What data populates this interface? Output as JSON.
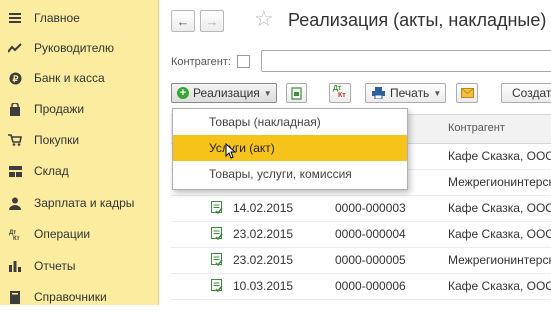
{
  "sidebar": {
    "items": [
      {
        "label": "Главное",
        "icon": "menu-icon"
      },
      {
        "label": "Руководителю",
        "icon": "trend-icon"
      },
      {
        "label": "Банк и касса",
        "icon": "coin-icon"
      },
      {
        "label": "Продажи",
        "icon": "bag-icon"
      },
      {
        "label": "Покупки",
        "icon": "cart-icon"
      },
      {
        "label": "Склад",
        "icon": "warehouse-icon"
      },
      {
        "label": "Зарплата и кадры",
        "icon": "person-icon"
      },
      {
        "label": "Операции",
        "icon": "operations-icon"
      },
      {
        "label": "Отчеты",
        "icon": "bar-chart-icon"
      },
      {
        "label": "Справочники",
        "icon": "book-icon"
      }
    ]
  },
  "header": {
    "back_glyph": "←",
    "forward_glyph": "→",
    "title": "Реализация (акты, накладные)"
  },
  "filter": {
    "label": "Контрагент:",
    "value": ""
  },
  "toolbar": {
    "create_label": "Реализация",
    "print_label": "Печать",
    "extra_label": "Создат",
    "dtkt_top": "Дт",
    "dtkt_bottom": "Кт"
  },
  "dropdown": {
    "items": [
      "Товары (накладная)",
      "Услуги (акт)",
      "Товары, услуги, комиссия"
    ],
    "highlighted": 1
  },
  "table": {
    "columns": [
      "",
      "",
      "Контрагент"
    ],
    "rows": [
      {
        "date": "",
        "number": "",
        "counterparty": "Кафе Сказка, ООО"
      },
      {
        "date": "",
        "number": "",
        "counterparty": "Межрегионинтерсна"
      },
      {
        "date": "14.02.2015",
        "number": "0000-000003",
        "counterparty": "Кафе Сказка, ООО"
      },
      {
        "date": "23.02.2015",
        "number": "0000-000004",
        "counterparty": "Кафе Сказка, ООО"
      },
      {
        "date": "23.02.2015",
        "number": "0000-000005",
        "counterparty": "Межрегионинтерсна"
      },
      {
        "date": "10.03.2015",
        "number": "0000-000006",
        "counterparty": "Кафе Сказка, ООО"
      }
    ]
  },
  "colors": {
    "sidebar_bg": "#fbeca0",
    "highlight": "#f5c319",
    "accent_green": "#3aa63a"
  }
}
